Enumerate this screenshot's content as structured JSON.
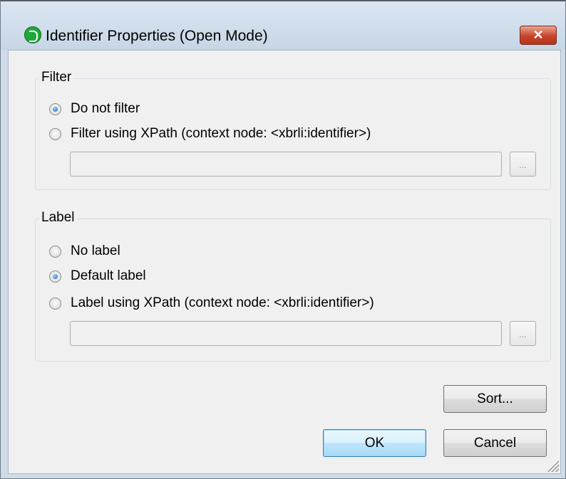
{
  "window": {
    "title": "Identifier Properties (Open Mode)",
    "close_glyph": "✕",
    "app_icon": "altova-app-icon"
  },
  "filter": {
    "group_label": "Filter",
    "options": [
      {
        "label": "Do not filter",
        "checked": true
      },
      {
        "label": "Filter using XPath (context node: <xbrli:identifier>)",
        "checked": false
      }
    ],
    "xpath_value": "",
    "browse_label": "..."
  },
  "label": {
    "group_label": "Label",
    "options": [
      {
        "label": "No label",
        "checked": false
      },
      {
        "label": "Default label",
        "checked": true
      },
      {
        "label": "Label using XPath (context node: <xbrli:identifier>)",
        "checked": false
      }
    ],
    "xpath_value": "",
    "browse_label": "..."
  },
  "buttons": {
    "sort": "Sort...",
    "ok": "OK",
    "cancel": "Cancel"
  }
}
